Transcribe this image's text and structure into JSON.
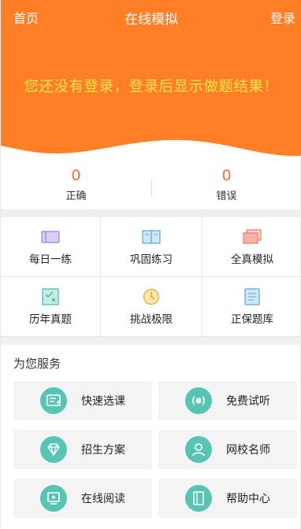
{
  "header": {
    "home": "首页",
    "title": "在线模拟",
    "login": "登录",
    "message": "您还没有登录，登录后显示做题结果！",
    "bg_color": "#ff7e26",
    "message_color": "#f6e64a"
  },
  "stats": {
    "correct_value": "0",
    "correct_label": "正确",
    "wrong_value": "0",
    "wrong_label": "错误"
  },
  "grid": {
    "items": [
      {
        "label": "每日一练",
        "icon": "daily-practice-icon"
      },
      {
        "label": "巩固练习",
        "icon": "consolidate-icon"
      },
      {
        "label": "全真模拟",
        "icon": "mock-exam-icon"
      },
      {
        "label": "历年真题",
        "icon": "past-papers-icon"
      },
      {
        "label": "挑战极限",
        "icon": "challenge-icon"
      },
      {
        "label": "正保题库",
        "icon": "question-bank-icon"
      }
    ]
  },
  "services": {
    "title": "为您服务",
    "accent": "#58c4b3",
    "items": [
      {
        "label": "快速选课",
        "icon": "course-select-icon"
      },
      {
        "label": "免费试听",
        "icon": "audio-icon"
      },
      {
        "label": "招生方案",
        "icon": "diamond-icon"
      },
      {
        "label": "网校名师",
        "icon": "teacher-icon"
      },
      {
        "label": "在线阅读",
        "icon": "reading-icon"
      },
      {
        "label": "帮助中心",
        "icon": "help-icon"
      }
    ]
  }
}
